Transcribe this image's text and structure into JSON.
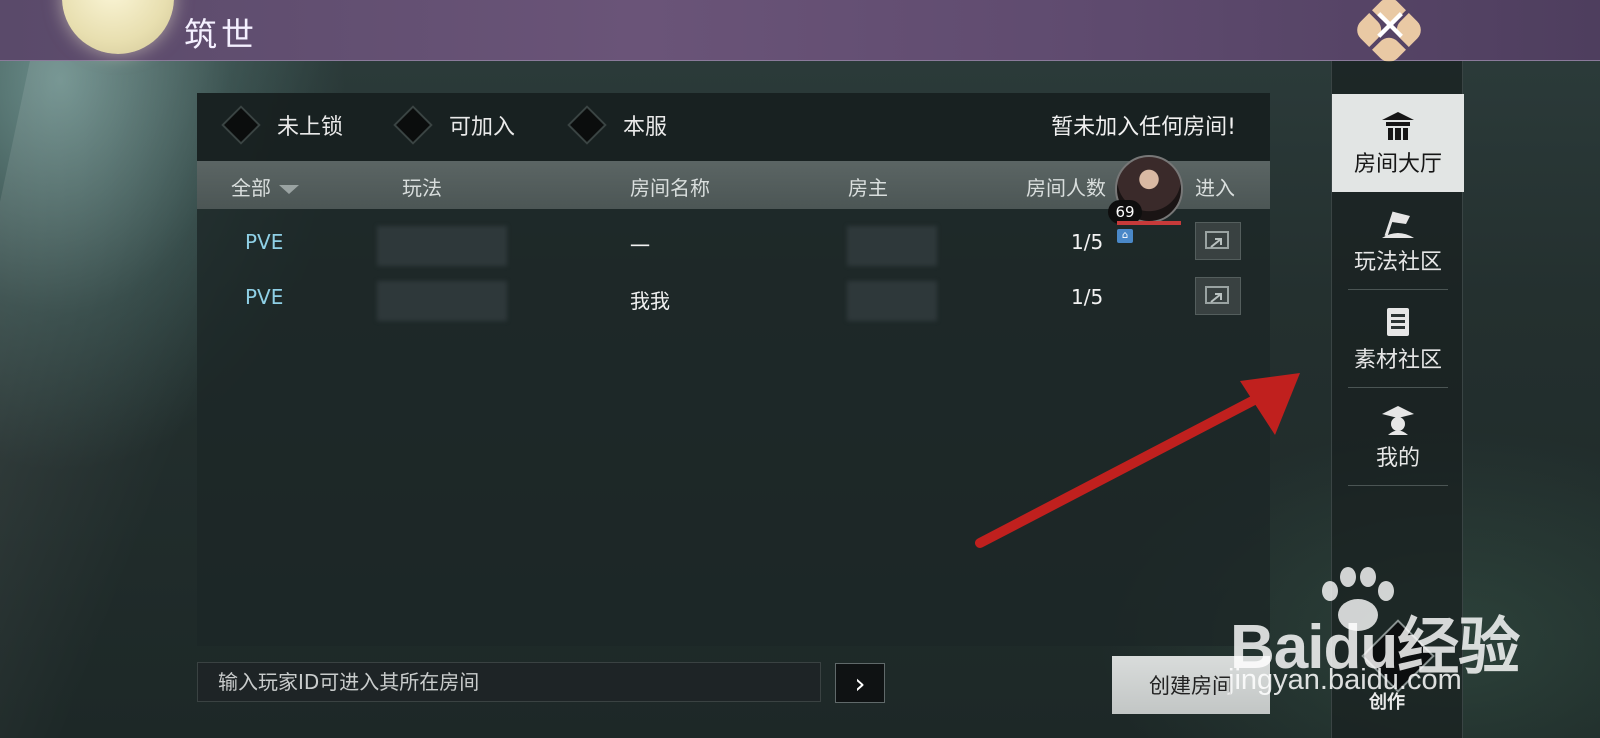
{
  "app": {
    "title": "筑世"
  },
  "filters": [
    {
      "label": "未上锁",
      "checked": false
    },
    {
      "label": "可加入",
      "checked": false
    },
    {
      "label": "本服",
      "checked": false
    }
  ],
  "status_text": "暂未加入任何房间!",
  "table": {
    "headers": {
      "all": "全部",
      "mode": "玩法",
      "room_name": "房间名称",
      "host": "房主",
      "count": "房间人数",
      "enter": "进入"
    },
    "rows": [
      {
        "mode": "PVE",
        "room_name": "一",
        "count": "1/5"
      },
      {
        "mode": "PVE",
        "room_name": "我我",
        "count": "1/5"
      }
    ]
  },
  "avatar": {
    "level": "69"
  },
  "search": {
    "placeholder": "输入玩家ID可进入其所在房间"
  },
  "create_room_label": "创建房间",
  "sidebar": {
    "items": [
      {
        "label": "房间大厅",
        "icon": "hall-icon",
        "active": true
      },
      {
        "label": "玩法社区",
        "icon": "flag-icon",
        "active": false
      },
      {
        "label": "素材社区",
        "icon": "document-icon",
        "active": false
      },
      {
        "label": "我的",
        "icon": "scholar-hat-icon",
        "active": false
      }
    ],
    "create_label": "创作"
  },
  "watermark": {
    "brand": "Bai",
    "brand_du": "du",
    "cn": "经验",
    "url": "jingyan.baidu.com"
  },
  "colors": {
    "accent_mode": "#8fd0e6",
    "annotation_arrow": "#c0201e",
    "topbar": "#6a5478"
  }
}
